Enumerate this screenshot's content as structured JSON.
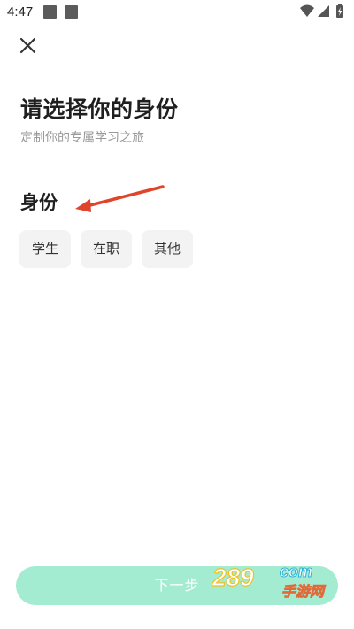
{
  "status_bar": {
    "time": "4:47",
    "icons": [
      "notification-square-icon",
      "notification-square-icon",
      "wifi-icon",
      "signal-icon",
      "battery-charging-icon"
    ]
  },
  "header": {
    "close_icon": "close-icon"
  },
  "main": {
    "title": "请选择你的身份",
    "subtitle": "定制你的专属学习之旅",
    "section_title": "身份",
    "options": [
      {
        "label": "学生"
      },
      {
        "label": "在职"
      },
      {
        "label": "其他"
      }
    ]
  },
  "footer": {
    "next_label": "下一步",
    "button_color": "#a3ecd1"
  },
  "watermark": {
    "brand": "289",
    "suffix": "com",
    "cn_text": "手游网"
  },
  "colors": {
    "accent": "#a3ecd1",
    "annotation_arrow": "#e0452b",
    "option_bg": "#f3f3f3"
  }
}
